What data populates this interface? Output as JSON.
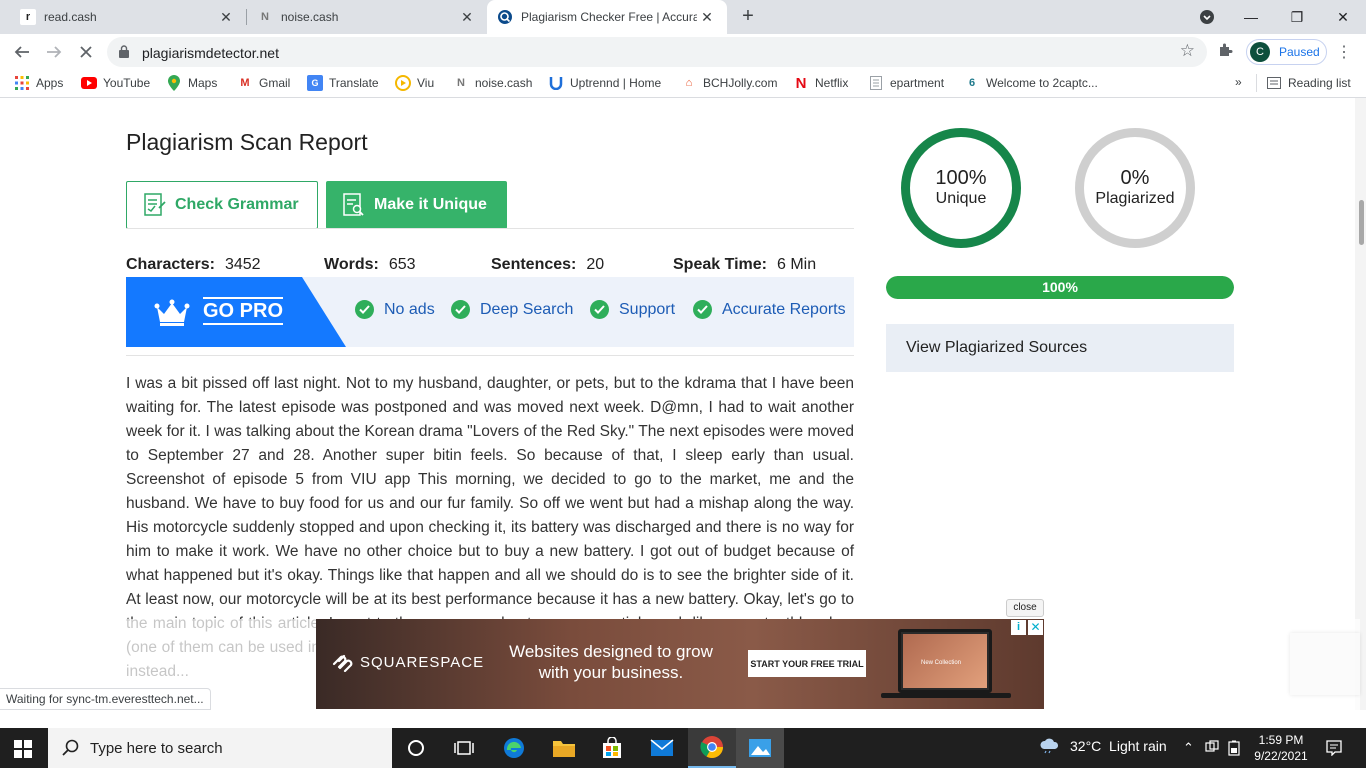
{
  "tabs": [
    {
      "title": "read.cash",
      "favicon": "r"
    },
    {
      "title": "noise.cash",
      "favicon": "N"
    },
    {
      "title": "Plagiarism Checker Free | Accura",
      "favicon": "Q"
    }
  ],
  "toolbar": {
    "url": "plagiarismdetector.net",
    "profile_initial": "C",
    "profile_status": "Paused"
  },
  "bookmarks": [
    {
      "label": "Apps",
      "icon": "apps-grid-icon"
    },
    {
      "label": "YouTube",
      "icon": "youtube-icon"
    },
    {
      "label": "Maps",
      "icon": "maps-pin-icon"
    },
    {
      "label": "Gmail",
      "icon": "gmail-icon"
    },
    {
      "label": "Translate",
      "icon": "translate-icon"
    },
    {
      "label": "Viu",
      "icon": "viu-icon"
    },
    {
      "label": "noise.cash",
      "icon": "noise-icon"
    },
    {
      "label": "Uptrennd | Home",
      "icon": "uptrennd-icon"
    },
    {
      "label": "BCHJolly.com",
      "icon": "bchjolly-icon"
    },
    {
      "label": "Netflix",
      "icon": "netflix-icon"
    },
    {
      "label": "epartment",
      "icon": "document-icon"
    },
    {
      "label": "Welcome to 2captc...",
      "icon": "captcha-icon"
    }
  ],
  "reading_list": "Reading list",
  "more_bookmarks": "»",
  "report": {
    "title": "Plagiarism Scan Report",
    "check_grammar": "Check Grammar",
    "make_unique": "Make it Unique",
    "stats": {
      "characters_label": "Characters:",
      "characters": "3452",
      "words_label": "Words:",
      "words": "653",
      "sentences_label": "Sentences:",
      "sentences": "20",
      "speak_label": "Speak Time:",
      "speak": "6 Min"
    },
    "go_pro": "GO PRO",
    "features": [
      "No ads",
      "Deep Search",
      "Support",
      "Accurate Reports"
    ],
    "text": "I was a bit pissed off last night. Not to my husband, daughter, or pets, but to the kdrama that I have been waiting for. The latest episode was postponed and was moved next week. D@mn, I had to wait another week for it. I was talking about the Korean drama \"Lovers of the Red Sky.\" The next episodes were moved to September 27 and 28. Another super bitin feels. So because of that, I sleep early than usual. Screenshot of episode 5 from VIU app This morning, we decided to go to the market, me and the husband. We have to buy food for us and our fur family. So off we went but had a mishap along the way. His motorcycle suddenly stopped and upon checking it, its battery was discharged and there is no way for him to make it work. We have no other choice but to buy a new battery. I got out of budget because of what happened but it's okay. Things like that happen and all we should do is to see the brighter side of it. At least now, our motorcycle will be at its best performance because it has a new battery. Okay, let's go to the main topic of this article. I went to the grocery and got some essentials such like soap, toothbrushes (one of them can be used in the laundry), and some items that can be used in the laundry. What I brought instead..."
  },
  "results": {
    "unique_pct": "100%",
    "unique_label": "Unique",
    "plag_pct": "0%",
    "plag_label": "Plagiarized",
    "progress_label": "100%",
    "progress_value": 1.0,
    "view_sources": "View Plagiarized Sources"
  },
  "ad": {
    "close": "close",
    "brand": "SQUARESPACE",
    "headline": "Websites designed to grow with your business.",
    "cta": "START YOUR FREE TRIAL",
    "laptop_text": "New Collection"
  },
  "status_bubble": "Waiting for sync-tm.everesttech.net...",
  "taskbar": {
    "search_placeholder": "Type here to search",
    "weather": "32°C  Light rain",
    "time": "1:59 PM",
    "date": "9/22/2021"
  },
  "colors": {
    "accent_green": "#36b36a",
    "unique_ring": "#16864a",
    "pro_blue": "#1479ff",
    "progress_green": "#2aa84a"
  }
}
